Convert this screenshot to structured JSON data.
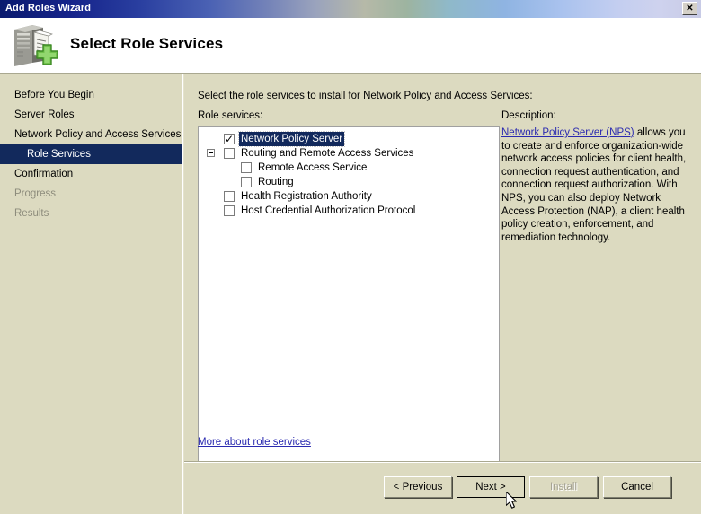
{
  "window": {
    "title": "Add Roles Wizard",
    "close_label": "✕"
  },
  "banner": {
    "heading": "Select Role Services",
    "icon": "server-add-icon"
  },
  "sidebar": {
    "items": [
      {
        "label": "Before You Begin",
        "state": "normal",
        "level": 0
      },
      {
        "label": "Server Roles",
        "state": "normal",
        "level": 0
      },
      {
        "label": "Network Policy and Access Services",
        "state": "normal",
        "level": 0
      },
      {
        "label": "Role Services",
        "state": "selected",
        "level": 1
      },
      {
        "label": "Confirmation",
        "state": "normal",
        "level": 0
      },
      {
        "label": "Progress",
        "state": "disabled",
        "level": 0
      },
      {
        "label": "Results",
        "state": "disabled",
        "level": 0
      }
    ]
  },
  "main": {
    "instruction": "Select the role services to install for Network Policy and Access Services:",
    "role_services_label": "Role services:",
    "description_label": "Description:",
    "more_link": "More about role services",
    "tree": [
      {
        "label": "Network Policy Server",
        "level": 0,
        "checked": true,
        "selected": true,
        "expander": "none"
      },
      {
        "label": "Routing and Remote Access Services",
        "level": 0,
        "checked": false,
        "selected": false,
        "expander": "minus"
      },
      {
        "label": "Remote Access Service",
        "level": 1,
        "checked": false,
        "selected": false,
        "expander": "none"
      },
      {
        "label": "Routing",
        "level": 1,
        "checked": false,
        "selected": false,
        "expander": "none"
      },
      {
        "label": "Health Registration Authority",
        "level": 0,
        "checked": false,
        "selected": false,
        "expander": "none"
      },
      {
        "label": "Host Credential Authorization Protocol",
        "level": 0,
        "checked": false,
        "selected": false,
        "expander": "none"
      }
    ],
    "description": {
      "link_text": "Network Policy Server (NPS)",
      "body": " allows you to create and enforce organization-wide network access policies for client health, connection request authentication, and connection request authorization. With NPS, you can also deploy Network Access Protection (NAP), a client health policy creation, enforcement, and remediation technology."
    }
  },
  "footer": {
    "buttons": [
      {
        "id": "btn-previous",
        "label": "< Previous",
        "state": "normal"
      },
      {
        "id": "btn-next",
        "label": "Next >",
        "state": "default"
      },
      {
        "id": "btn-install",
        "label": "Install",
        "state": "disabled"
      },
      {
        "id": "btn-cancel",
        "label": "Cancel",
        "state": "normal"
      }
    ]
  },
  "colors": {
    "background": "#dcdac0",
    "selection": "#12295c",
    "link": "#2a2ab0",
    "title_start": "#0a1a6e"
  }
}
